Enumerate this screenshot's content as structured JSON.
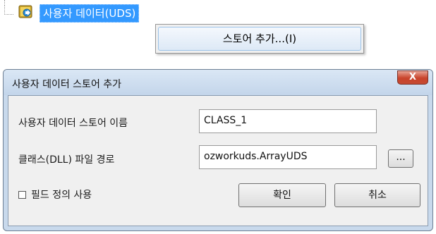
{
  "tree": {
    "item_label": "사용자 데이터(UDS)",
    "item_icon": "data-store-icon"
  },
  "context_menu": {
    "items": [
      {
        "label": "스토어 추가...(I)"
      }
    ]
  },
  "dialog": {
    "title": "사용자 데이터 스토어 추가",
    "close_label": "X",
    "fields": {
      "store_name_label": "사용자 데이터 스토어 이름",
      "store_name_value": "CLASS_1",
      "class_path_label": "클래스(DLL) 파일 경로",
      "class_path_value": "ozworkuds.ArrayUDS",
      "browse_label": "..."
    },
    "field_def_checkbox": {
      "label": "필드 정의 사용",
      "checked": false
    },
    "ok_label": "확인",
    "cancel_label": "취소"
  },
  "colors": {
    "selection": "#3399ff",
    "dialog_frame": "#c8d9ec",
    "close_button": "#c8432b"
  }
}
